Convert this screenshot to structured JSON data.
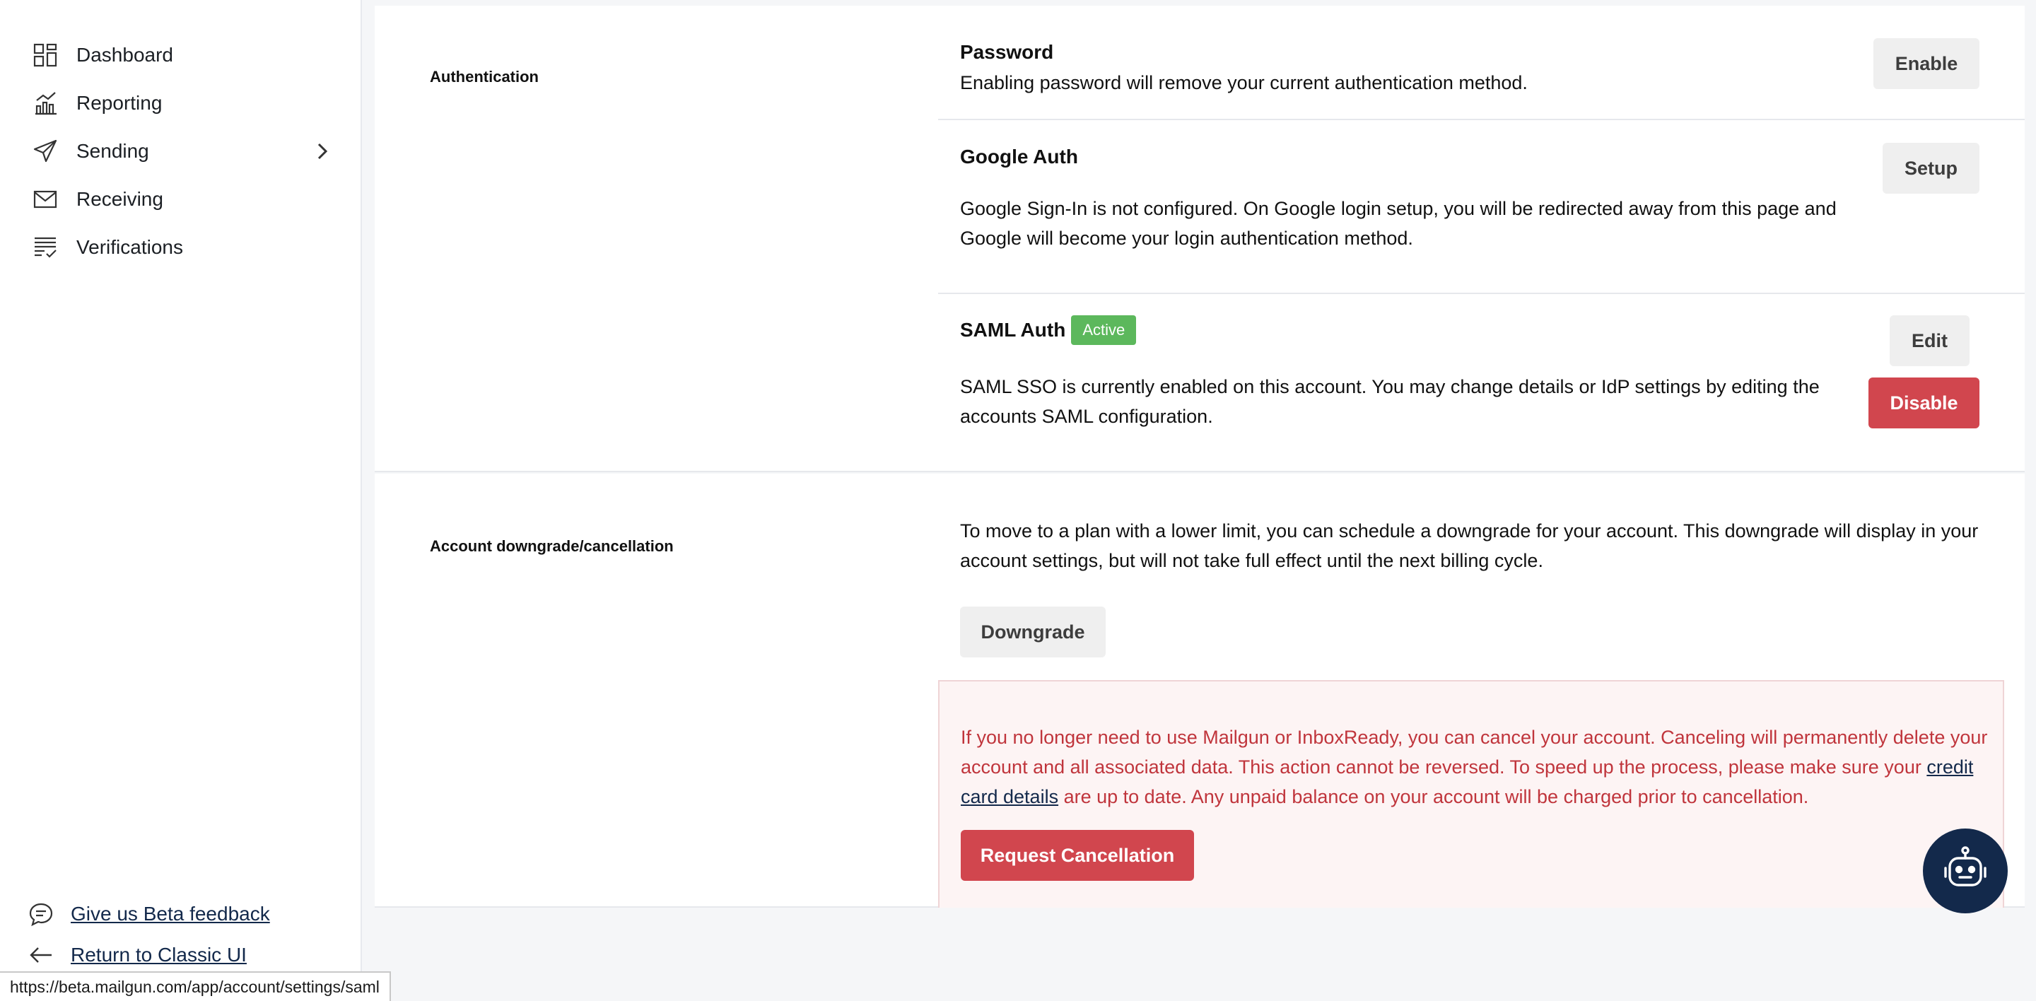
{
  "sidebar": {
    "items": [
      {
        "label": "Dashboard",
        "icon": "dashboard-icon"
      },
      {
        "label": "Reporting",
        "icon": "chart-icon"
      },
      {
        "label": "Sending",
        "icon": "send-icon"
      },
      {
        "label": "Receiving",
        "icon": "mail-icon"
      },
      {
        "label": "Verifications",
        "icon": "checklist-icon"
      }
    ],
    "footer": {
      "feedback_label": "Give us Beta feedback",
      "classic_label": "Return to Classic UI"
    }
  },
  "authentication": {
    "section_label": "Authentication",
    "password": {
      "title": "Password",
      "description": "Enabling password will remove your current authentication method.",
      "button": "Enable"
    },
    "google": {
      "title": "Google Auth",
      "description": "Google Sign-In is not configured. On Google login setup, you will be redirected away from this page and Google will become your login authentication method.",
      "button": "Setup"
    },
    "saml": {
      "title": "SAML Auth",
      "badge": "Active",
      "description": "SAML SSO is currently enabled on this account. You may change details or IdP settings by editing the accounts SAML configuration.",
      "edit_button": "Edit",
      "disable_button": "Disable"
    }
  },
  "downgrade": {
    "section_label": "Account downgrade/cancellation",
    "description": "To move to a plan with a lower limit, you can schedule a downgrade for your account. This downgrade will display in your account settings, but will not take full effect until the next billing cycle.",
    "button": "Downgrade"
  },
  "cancellation": {
    "text_before": "If you no longer need to use Mailgun or InboxReady, you can cancel your account. Canceling will permanently delete your account and all associated data. This action cannot be reversed.  To speed up the process, please make sure your ",
    "link": "credit card details",
    "text_after": " are up to date. Any unpaid balance on your account will be charged prior to cancellation.",
    "button": "Request Cancellation"
  },
  "status_url": "https://beta.mailgun.com/app/account/settings/saml",
  "colors": {
    "navy": "#13294b",
    "danger": "#d1464e",
    "success": "#5cb85c"
  }
}
